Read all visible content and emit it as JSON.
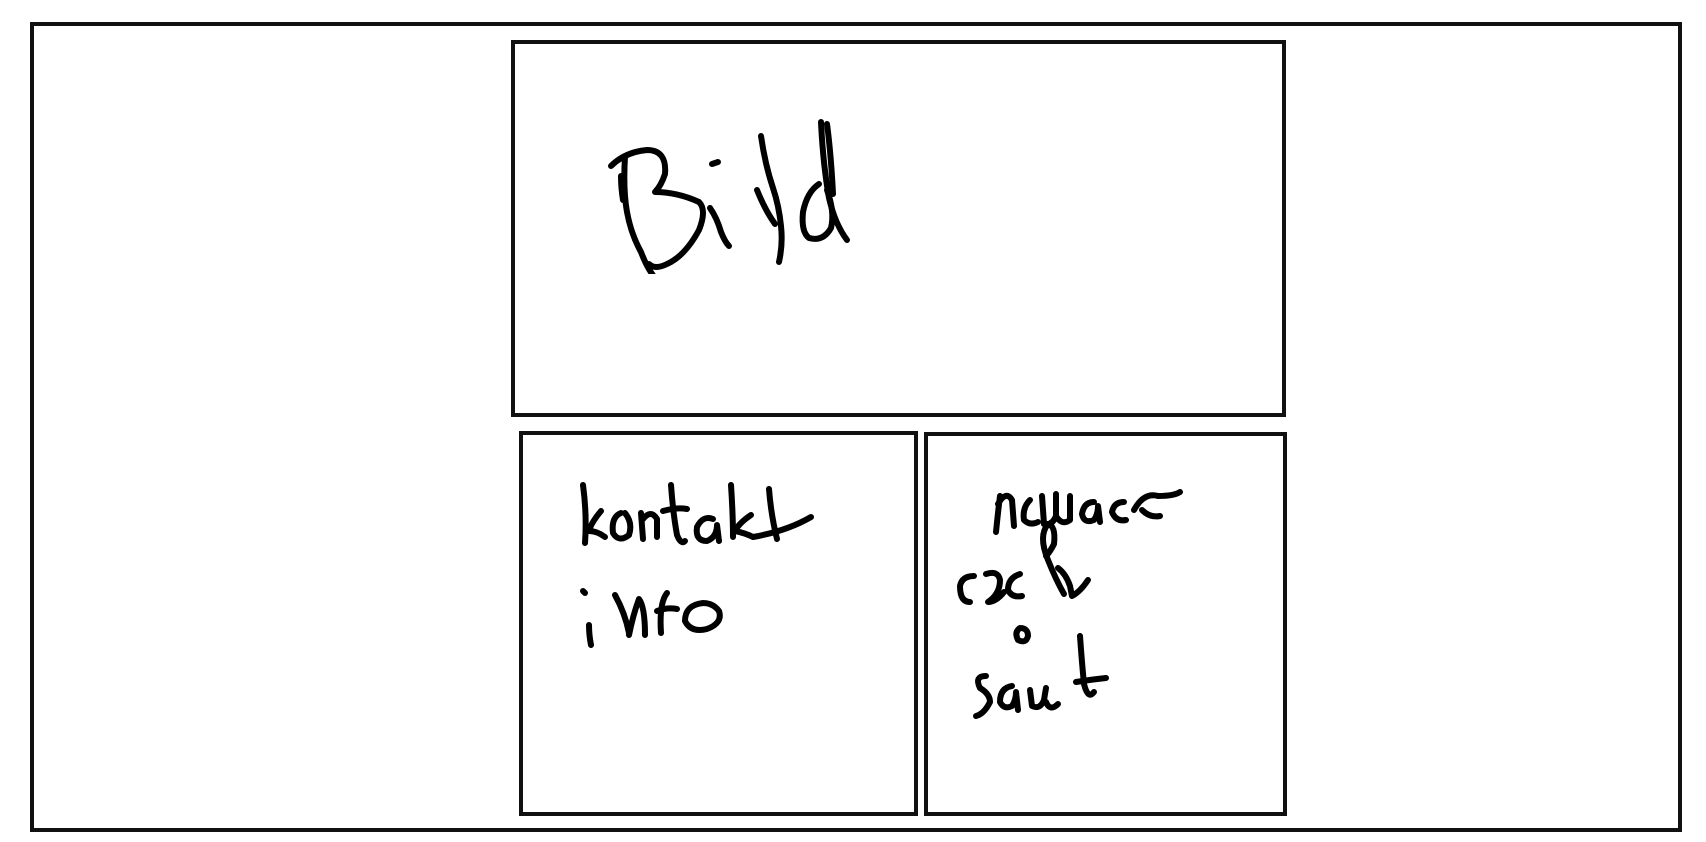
{
  "wireframe": {
    "image_box": {
      "label": "Bild"
    },
    "contact_box": {
      "line1": "kontakt",
      "line2": "info"
    }
  }
}
